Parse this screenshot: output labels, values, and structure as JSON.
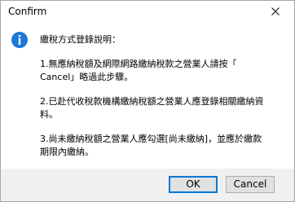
{
  "window": {
    "title": "Confirm"
  },
  "message": {
    "heading": "繳稅方式登錄說明：",
    "item1_line1": "1.無應納稅額及網際網路繳納稅款之營業人請按「",
    "item1_line2": "Cancel」略過此步驟。",
    "item2_line1": "2.已赴代收稅款機構繳納稅額之營業人應登錄相關繳納資",
    "item2_line2": "料。",
    "item3_line1": "3.尚未繳納稅額之營業人應勾選[尚未繳納]，並應於繳款",
    "item3_line2": "期限內繳納。"
  },
  "buttons": {
    "ok_label": "OK",
    "cancel_label": "Cancel"
  },
  "colors": {
    "info_icon": "#1e78d7",
    "ok_focus_border": "#0078d7",
    "footer_bg": "#f0f0f0"
  },
  "icons": {
    "info": "info-icon",
    "close": "close-icon"
  }
}
